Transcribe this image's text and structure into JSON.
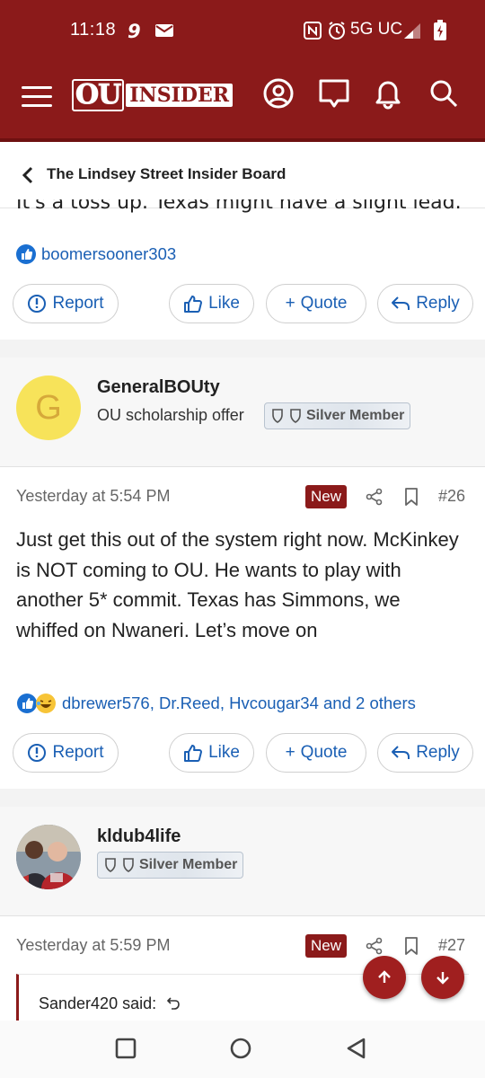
{
  "status": {
    "time": "11:18",
    "network": "5G UC"
  },
  "app": {
    "logo_ou": "OU",
    "logo_insider": "INSIDER"
  },
  "breadcrumb": {
    "label": "The Lindsey Street Insider Board"
  },
  "post_prev": {
    "cut_text": "It's a toss up. Texas might have a slight lead.",
    "reactions_text": "boomersooner303"
  },
  "actions": {
    "report": "Report",
    "like": "Like",
    "quote": "Quote",
    "reply": "Reply"
  },
  "post26": {
    "author": "GeneralBOUty",
    "avatar_letter": "G",
    "user_title": "OU scholarship offer",
    "badge": "Silver Member",
    "date": "Yesterday at 5:54 PM",
    "new_label": "New",
    "number": "#26",
    "body": "Just get this out of the system right now. McKinkey is NOT coming to OU. He wants to play with another 5* commit. Texas has Simmons, we whiffed on Nwaneri. Let’s move on",
    "reactions_text": "dbrewer576, Dr.Reed, Hvcougar34 and 2 others"
  },
  "post27": {
    "author": "kldub4life",
    "badge": "Silver Member",
    "date": "Yesterday at 5:59 PM",
    "new_label": "New",
    "number": "#27",
    "quote_author": "Sander420 said:"
  },
  "colors": {
    "brand": "#8b1a1a",
    "link": "#1a5fb4"
  },
  "icons": [
    "menu-icon",
    "user-icon",
    "chat-icon",
    "bell-icon",
    "search-icon",
    "share-icon",
    "bookmark-icon",
    "report-icon",
    "like-icon",
    "reply-icon"
  ]
}
